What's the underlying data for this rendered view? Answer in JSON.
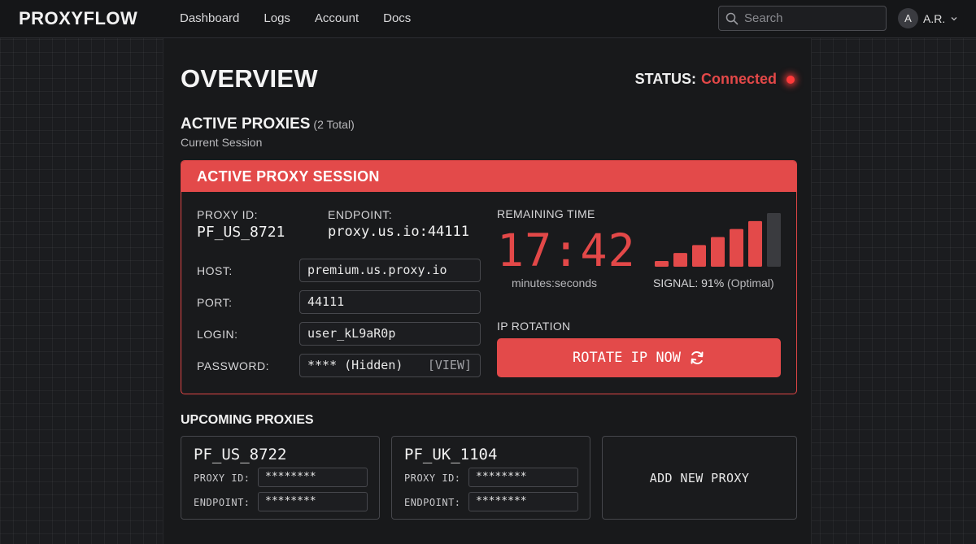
{
  "app": {
    "brand": "PROXYFLOW"
  },
  "nav": {
    "items": [
      "Dashboard",
      "Logs",
      "Account",
      "Docs"
    ]
  },
  "search": {
    "placeholder": "Search",
    "icon": "search-icon"
  },
  "user": {
    "initial": "A",
    "name": "A.R.",
    "icon": "chevron-down-icon"
  },
  "page": {
    "title": "OVERVIEW",
    "status_label": "STATUS:",
    "status_value": "Connected",
    "status_color": "#e34848"
  },
  "active": {
    "heading": "ACTIVE PROXIES",
    "count": "(2 Total)",
    "subtitle": "Current Session"
  },
  "session": {
    "header": "ACTIVE PROXY SESSION",
    "proxy_id_label": "PROXY ID:",
    "proxy_id": "PF_US_8721",
    "endpoint_label": "ENDPOINT:",
    "endpoint": "proxy.us.io:44111",
    "host_label": "HOST:",
    "host": "premium.us.proxy.io",
    "port_label": "PORT:",
    "port": "44111",
    "login_label": "LOGIN:",
    "login": "user_kL9aR0p",
    "password_label": "PASSWORD:",
    "password": "**** (Hidden)",
    "view_label": "[VIEW]",
    "timer_label": "REMAINING TIME",
    "timer": "17:42",
    "timer_unit": "minutes:seconds",
    "signal_prefix": "SIGNAL: 91%",
    "signal_suffix": "(Optimal)",
    "signal_percent": 91,
    "signal_bars_total": 7,
    "signal_bars_active": 6,
    "rotation_label": "IP ROTATION",
    "rotate_button": "ROTATE IP NOW",
    "rotate_icon": "refresh-icon",
    "accent_color": "#e34a4a"
  },
  "upcoming": {
    "heading": "UPCOMING PROXIES",
    "cards": [
      {
        "title": "PF_US_8722",
        "proxy_id_label": "PROXY ID:",
        "proxy_id": "********",
        "endpoint_label": "ENDPOINT:",
        "endpoint": "********"
      },
      {
        "title": "PF_UK_1104",
        "proxy_id_label": "PROXY ID:",
        "proxy_id": "********",
        "endpoint_label": "ENDPOINT:",
        "endpoint": "********"
      }
    ],
    "add_label": "ADD NEW PROXY"
  }
}
